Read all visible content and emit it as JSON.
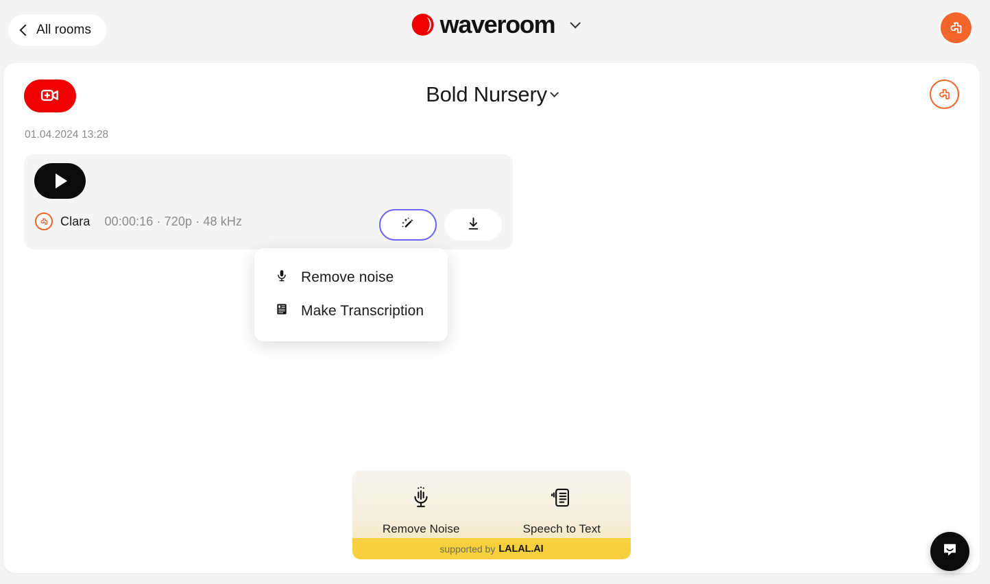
{
  "topbar": {
    "back_button_label": "All rooms",
    "back_icon": "chevron-left-icon",
    "brand_name": "waveroom",
    "brand_icon": "waveroom-logo-icon",
    "brand_dropdown_icon": "chevron-down-icon",
    "account_avatar_icon": "account-avatar-icon"
  },
  "panel": {
    "record_button_icon": "video-plus-icon",
    "room_title": "Bold Nursery",
    "room_dropdown_icon": "chevron-down-icon",
    "room_avatar_icon": "account-avatar-icon",
    "session_date": "01.04.2024 13:28"
  },
  "recording": {
    "play_icon": "play-icon",
    "speaker_avatar_icon": "account-avatar-icon",
    "speaker_name": "Clara",
    "specs": "00:00:16 · 720p · 48 kHz",
    "duration": "00:00:16",
    "resolution": "720p",
    "sample_rate": "48 kHz",
    "enhance_button_icon": "magic-wand-icon",
    "download_button_icon": "download-icon"
  },
  "menu": {
    "items": [
      {
        "label": "Remove noise",
        "icon": "microphone-icon"
      },
      {
        "label": "Make Transcription",
        "icon": "transcription-icon"
      }
    ]
  },
  "promo": {
    "actions": [
      {
        "label": "Remove Noise",
        "icon": "noise-microphone-icon"
      },
      {
        "label": "Speech to Text",
        "icon": "speech-to-text-icon"
      }
    ],
    "footer_prefix": "supported by",
    "footer_brand": "LALAL.AI"
  },
  "support": {
    "chat_icon": "intercom-chat-icon"
  },
  "colors": {
    "brand_red": "#ef0000",
    "accent_orange": "#f4652b",
    "accent_purple": "#6c63ff",
    "promo_yellow": "#f7d13d",
    "page_bg": "#f4f4f5"
  }
}
